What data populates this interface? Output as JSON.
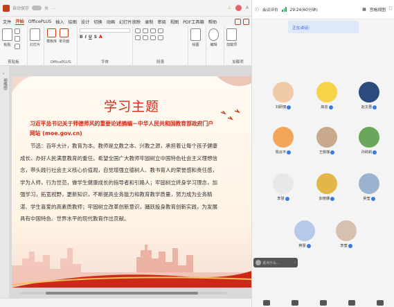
{
  "titlebar": {
    "autosave_label": "自动保存",
    "autosave_state": "关",
    "doc_name": "…",
    "user_badge": "A",
    "warn_icon": "warning-icon"
  },
  "ribbon_tabs": [
    "文件",
    "开始",
    "OfficePLUS",
    "插入",
    "绘图",
    "设计",
    "切换",
    "动画",
    "幻灯片放映",
    "录制",
    "审阅",
    "视图",
    "PDF工具箱",
    "帮助"
  ],
  "active_tab": "开始",
  "ribbon": {
    "paste": "粘贴",
    "clipboard_group": "剪贴板",
    "new_slide": "幻灯片",
    "template_lib": "模板库",
    "single_page": "单页面",
    "officeplus_group": "OfficePLUS",
    "font_group": "字体",
    "paragraph_group": "段落",
    "drawing": "绘图",
    "editing": "编辑",
    "addin": "加载项",
    "addin_group": "加载项"
  },
  "left_strip": {
    "label": "缩略图"
  },
  "slide": {
    "title": "学习主题",
    "subtitle": "习近平总书记关于师德师风的重要论述摘编－中华人民共和国教育部政府门户网站 (moe.gov.cn)",
    "body": "节选：百年大计，教育为本。教师是立教之本、兴教之源，承担着让每个孩子健康成长、办好人民满意教育的重任。希望全国广大教师牢固树立中国特色社会主义理想信念，带头践行社会主义核心价值观，自觉增强立德树人、教书育人的荣誉感和责任感，学为人师，行为世范，做学生健康成长的指导者和引路人；牢固树立终身学习理念，加强学习，拓宽视野，更新知识，不断提高业务能力和教育教学质量，努力成为业务精湛、学生喜爱的高素质教师；牢固树立改革创新意识，踊跃投身教育创新实践，为发展具有中国特色、世界水平的现代教育作出贡献。"
  },
  "meeting": {
    "top_title": "会议评价",
    "timer": "29:24(60分钟)",
    "view_label": "宫格视图",
    "notice": "正在讲话:",
    "participants": [
      {
        "name": "刘研丽",
        "avatar_color": "#f0c9a8"
      },
      {
        "name": "高芸",
        "avatar_color": "#f7d34a"
      },
      {
        "name": "赵文惠",
        "avatar_color": "#2b4b7c"
      },
      {
        "name": "陈云平",
        "avatar_color": "#f3a65a"
      },
      {
        "name": "王茹珈",
        "avatar_color": "#c9a98b"
      },
      {
        "name": "孙莉莉",
        "avatar_color": "#6aa65b"
      },
      {
        "name": "李慧",
        "avatar_color": "#e8e8e8"
      },
      {
        "name": "彭丽娜",
        "avatar_color": "#e3b64a"
      },
      {
        "name": "吴莹",
        "avatar_color": "#9bb3cf"
      },
      {
        "name": "蒋慧",
        "avatar_color": "#b7c8e8"
      },
      {
        "name": "李莹",
        "avatar_color": "#d8c0b0"
      }
    ],
    "chat_placeholder": "说点什么..."
  }
}
